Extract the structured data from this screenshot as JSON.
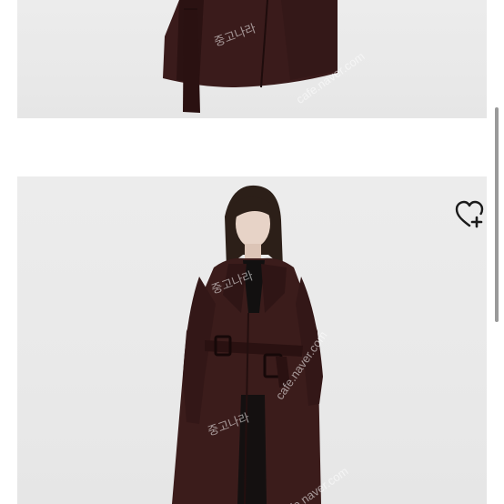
{
  "listing": {
    "images": [
      {
        "name": "coat-detail-photo"
      },
      {
        "name": "coat-model-photo"
      }
    ],
    "watermarks": [
      "cafe.naver.com",
      "중고나라"
    ],
    "wishlist_icon": "heart-plus-icon"
  },
  "colors": {
    "coat": "#3b1c1b",
    "background": "#e9e9e9",
    "icon": "#1a1a1a"
  }
}
